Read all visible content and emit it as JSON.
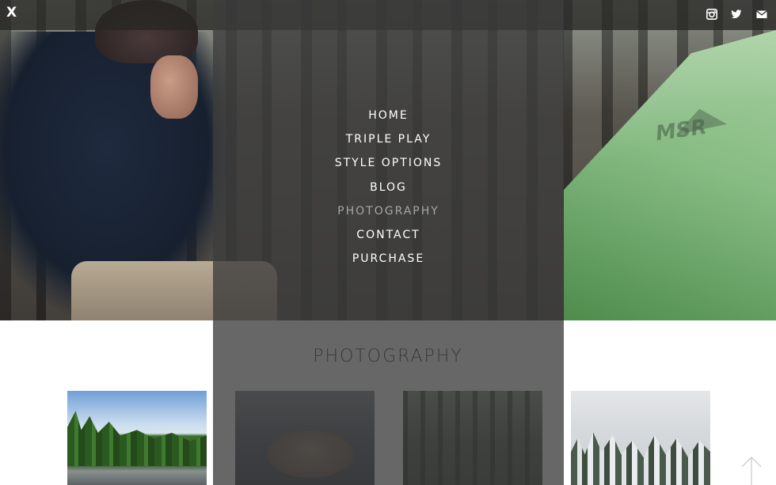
{
  "header": {
    "close_label": "X",
    "social_icons": [
      "instagram-icon",
      "twitter-icon",
      "email-icon"
    ]
  },
  "menu": {
    "items": [
      {
        "label": "HOME",
        "active": false
      },
      {
        "label": "TRIPLE PLAY",
        "active": false
      },
      {
        "label": "STYLE OPTIONS",
        "active": false
      },
      {
        "label": "BLOG",
        "active": false
      },
      {
        "label": "PHOTOGRAPHY",
        "active": true
      },
      {
        "label": "CONTACT",
        "active": false
      },
      {
        "label": "PURCHASE",
        "active": false
      }
    ]
  },
  "hero": {
    "tent_logo": "MSR"
  },
  "section": {
    "title": "PHOTOGRAPHY"
  },
  "gallery": {
    "thumbnails": [
      "mountain-river-photo",
      "river-rocks-photo",
      "misty-forest-photo",
      "snowy-trees-photo"
    ]
  },
  "back_to_top": {
    "icon": "arrow-up-icon"
  },
  "colors": {
    "overlay": "#3c3c3c",
    "menu_text": "#ffffff",
    "menu_active": "#a7a7a7",
    "title": "#2c2c2c"
  }
}
